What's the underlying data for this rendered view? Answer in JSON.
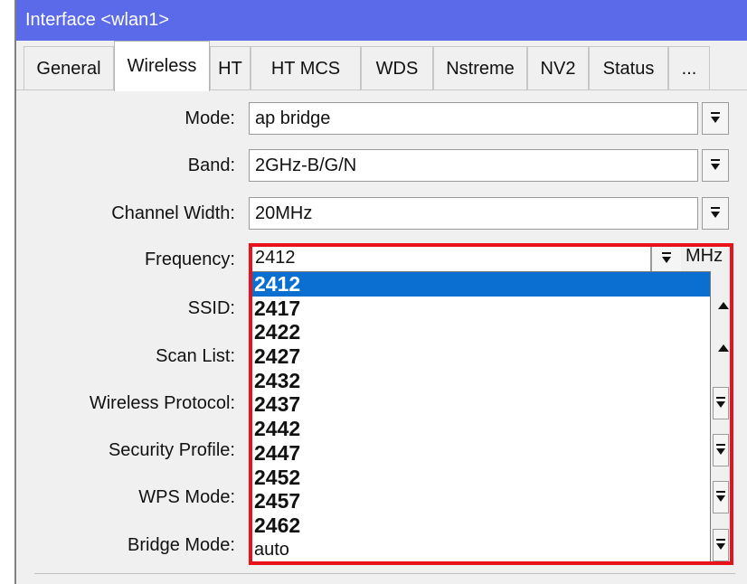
{
  "window": {
    "title": "Interface <wlan1>"
  },
  "tabs": [
    {
      "label": "General"
    },
    {
      "label": "Wireless"
    },
    {
      "label": "HT"
    },
    {
      "label": "HT MCS"
    },
    {
      "label": "WDS"
    },
    {
      "label": "Nstreme"
    },
    {
      "label": "NV2"
    },
    {
      "label": "Status"
    },
    {
      "label": "..."
    }
  ],
  "active_tab": "Wireless",
  "fields": {
    "mode": {
      "label": "Mode:",
      "value": "ap bridge"
    },
    "band": {
      "label": "Band:",
      "value": "2GHz-B/G/N"
    },
    "channel_width": {
      "label": "Channel Width:",
      "value": "20MHz"
    },
    "frequency": {
      "label": "Frequency:",
      "value": "2412",
      "unit": "MHz"
    },
    "ssid": {
      "label": "SSID:"
    },
    "scan_list": {
      "label": "Scan List:"
    },
    "wireless_protocol": {
      "label": "Wireless Protocol:"
    },
    "security_profile": {
      "label": "Security Profile:"
    },
    "wps_mode": {
      "label": "WPS Mode:"
    },
    "bridge_mode": {
      "label": "Bridge Mode:"
    }
  },
  "frequency_options": [
    "2412",
    "2417",
    "2422",
    "2427",
    "2432",
    "2437",
    "2442",
    "2447",
    "2452",
    "2457",
    "2462",
    "auto"
  ],
  "selected_frequency": "2412",
  "colors": {
    "titlebar": "#5b6ae8",
    "selection": "#0a6fd0",
    "highlight_border": "#e8121b"
  }
}
